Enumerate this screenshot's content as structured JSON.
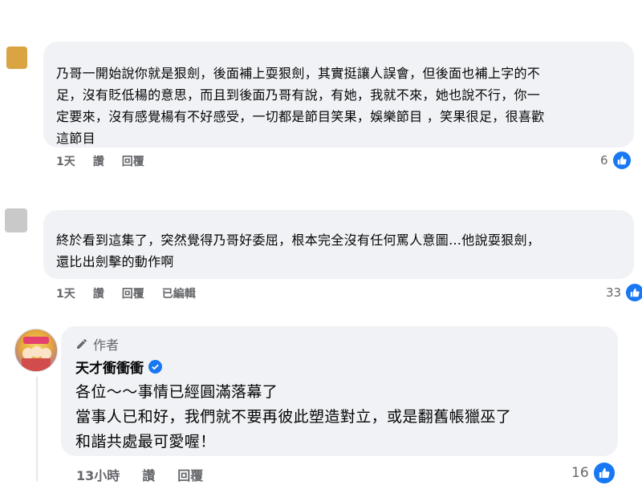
{
  "comments": [
    {
      "text": "乃哥一開始說你就是狠劍，後面補上耍狠劍，其實挺讓人誤會，但後面也補上字的不\n足，沒有貶低楊的意思，而且到後面乃哥有說，有她，我就不來，她也說不行，你一\n定要來，沒有感覺楊有不好感受，一切都是節目笑果，娛樂節目 ，笑果很足，很喜歡\n這節目",
      "time": "1天",
      "like_label": "讚",
      "reply_label": "回覆",
      "reactions": "6"
    },
    {
      "text": "終於看到這集了，突然覺得乃哥好委屈，根本完全沒有任何罵人意圖…他說耍狠劍，\n還比出劍擊的動作啊",
      "time": "1天",
      "like_label": "讚",
      "reply_label": "回覆",
      "edited_label": "已編輯",
      "reactions": "33"
    }
  ],
  "author_reply": {
    "author_tag": "作者",
    "name": "天才衝衝衝",
    "text": "各位～～事情已經圓滿落幕了\n當事人已和好，我們就不要再彼此塑造對立，或是翻舊帳獵巫了\n和諧共處最可愛喔！",
    "time": "13小時",
    "like_label": "讚",
    "reply_label": "回覆",
    "reactions": "16"
  },
  "colors": {
    "bubble": "#f0f2f5",
    "like_blue": "#1877f2",
    "meta_gray": "#65676b"
  }
}
